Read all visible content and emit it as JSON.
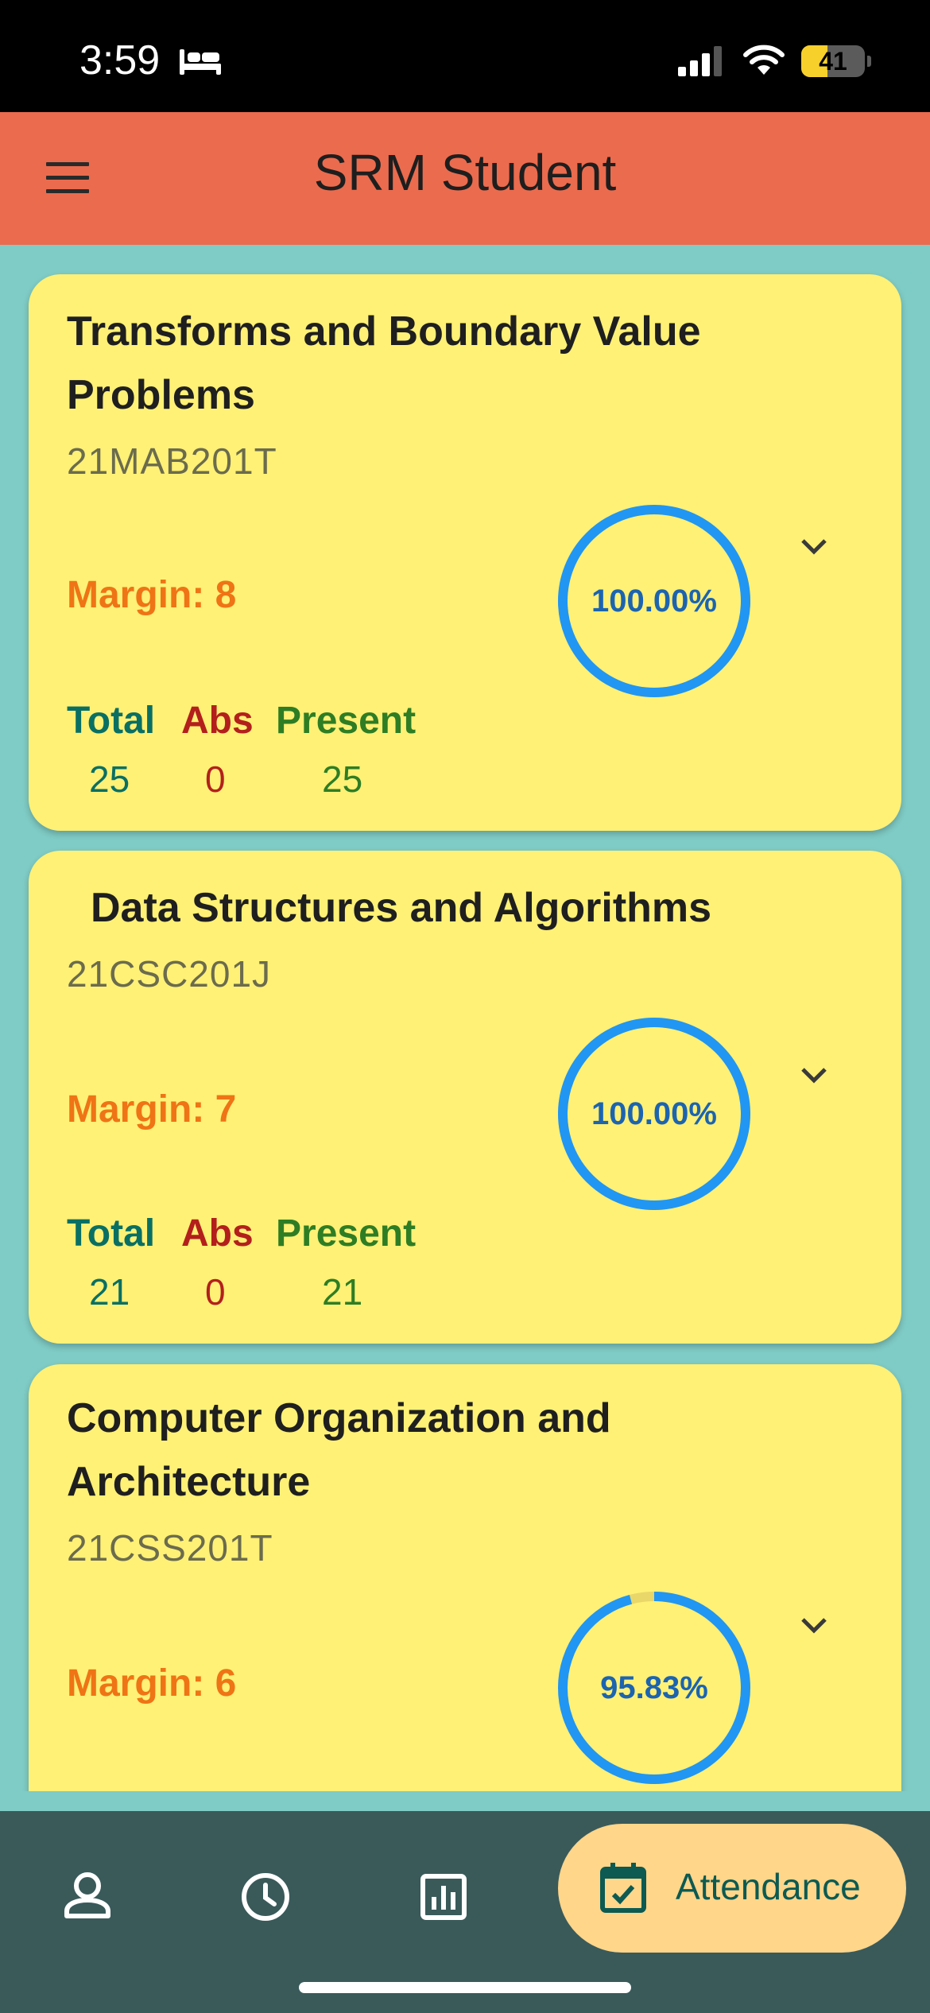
{
  "status_bar": {
    "time": "3:59",
    "battery_level": "41",
    "icons": [
      "bed-icon",
      "signal-icon",
      "wifi-icon",
      "battery-icon"
    ]
  },
  "app_bar": {
    "title": "SRM Student",
    "menu_icon": "menu-icon"
  },
  "labels": {
    "total": "Total",
    "abs": "Abs",
    "present": "Present"
  },
  "courses": [
    {
      "name": "Transforms and Boundary Value Problems",
      "code": "21MAB201T",
      "margin": "Margin: 8",
      "percentage_text": "100.00%",
      "percentage": 100.0,
      "total": "25",
      "abs": "0",
      "present": "25"
    },
    {
      "name": "Data Structures and Algorithms",
      "code": "21CSC201J",
      "margin": "Margin: 7",
      "percentage_text": "100.00%",
      "percentage": 100.0,
      "total": "21",
      "abs": "0",
      "present": "21"
    },
    {
      "name": "Computer Organization and Architecture",
      "code": "21CSS201T",
      "margin": "Margin: 6",
      "percentage_text": "95.83%",
      "percentage": 95.83
    }
  ],
  "bottom_nav": {
    "items": [
      "profile-icon",
      "clock-icon",
      "chart-icon",
      "calendar-check-icon"
    ],
    "active_label": "Attendance"
  },
  "colors": {
    "app_bar": "#eb6b4e",
    "background": "#7fcbc5",
    "card": "#fff176",
    "gauge_ring": "#2196f3",
    "margin_text": "#ef7415",
    "nav_background": "#3a5a5a",
    "nav_active": "#ffd68a"
  }
}
